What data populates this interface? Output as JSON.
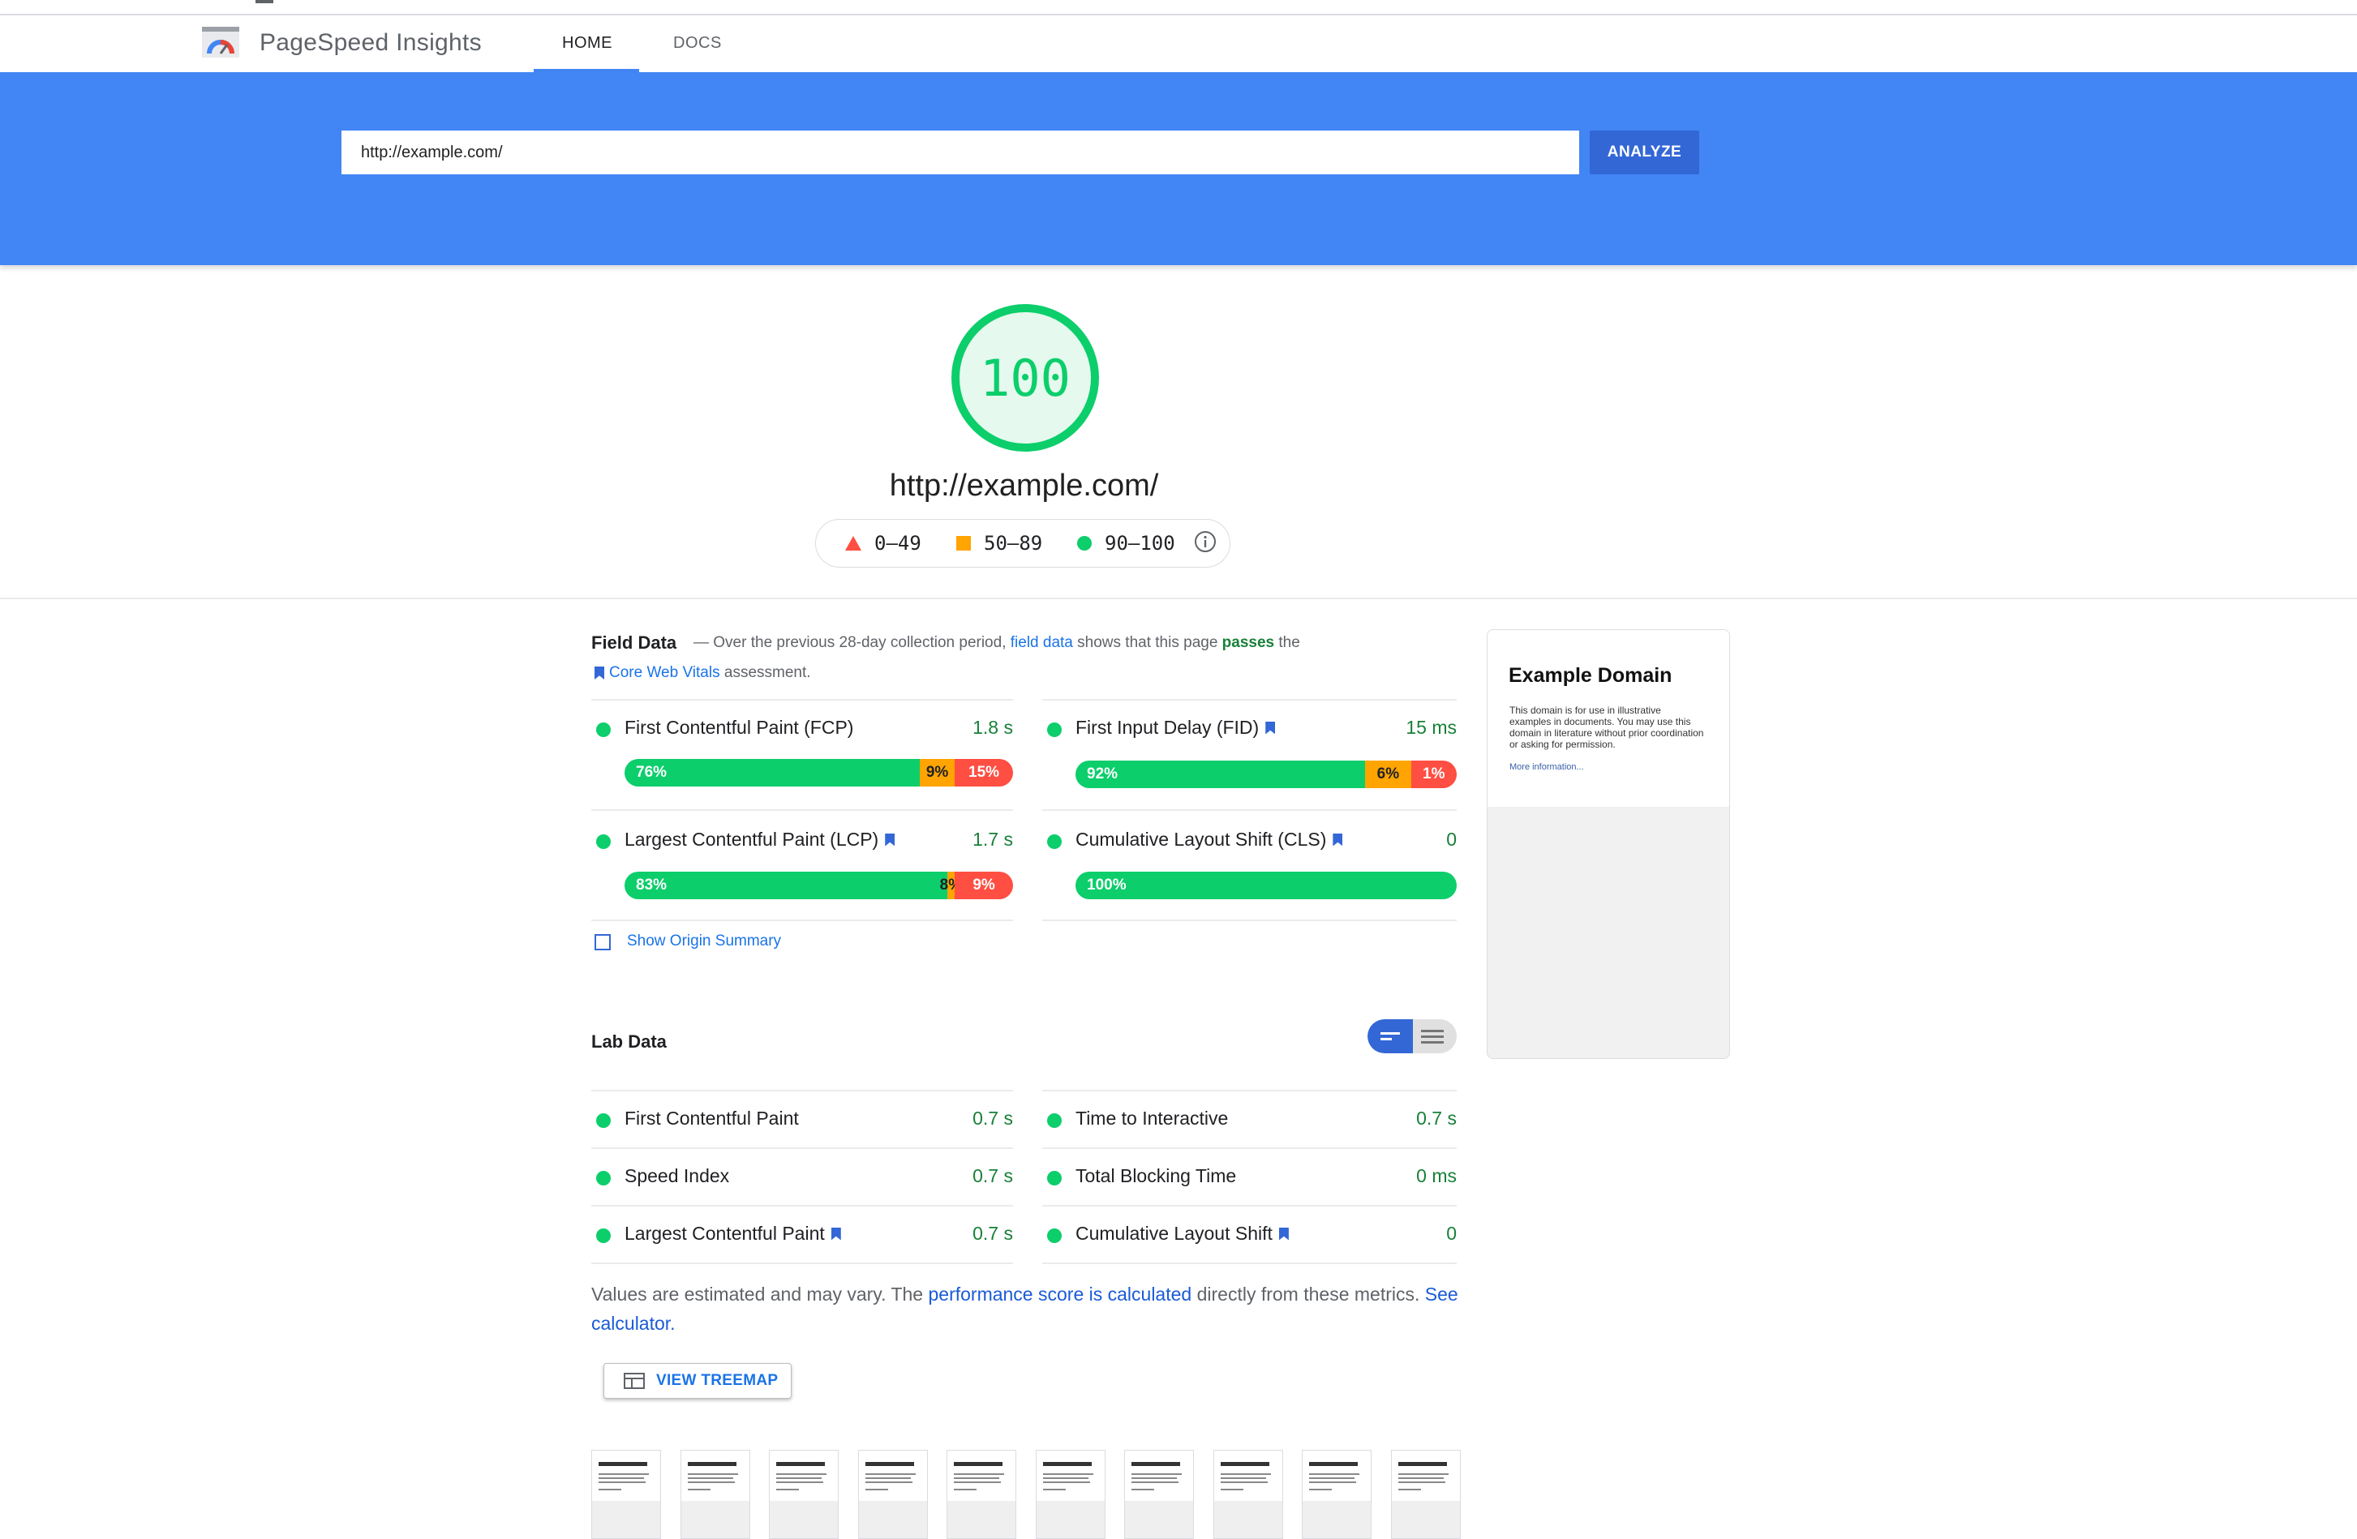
{
  "header": {
    "brand": "PageSpeed Insights",
    "tabs": [
      {
        "label": "HOME"
      },
      {
        "label": "DOCS"
      }
    ]
  },
  "search": {
    "url_value": "http://example.com/",
    "analyze_label": "ANALYZE"
  },
  "score": {
    "value": "100",
    "url": "http://example.com/"
  },
  "legend": {
    "low": "0–49",
    "mid": "50–89",
    "high": "90–100"
  },
  "colors": {
    "pass": "#0cce6b",
    "average": "#ffa400",
    "fail": "#ff4e42",
    "accent": "#4285f4"
  },
  "field_data": {
    "title": "Field Data",
    "desc_prefix": "— Over the previous 28-day collection period,",
    "desc_link": "field data",
    "desc_mid": "shows that this page",
    "desc_pass": "passes",
    "desc_end": "the",
    "cwv_link": "Core Web Vitals",
    "assessment": "assessment.",
    "metrics": [
      {
        "name": "First Contentful Paint (FCP)",
        "value": "1.8 s",
        "good": "76%",
        "avg": "9%",
        "poor": "15%",
        "good_pct": 76,
        "avg_pct": 9,
        "poor_pct": 15
      },
      {
        "name": "First Input Delay (FID)",
        "value": "15 ms",
        "good": "92%",
        "avg": "6%",
        "poor": "1%",
        "good_pct": 76,
        "avg_pct": 12,
        "poor_pct": 12
      },
      {
        "name": "Largest Contentful Paint (LCP)",
        "value": "1.7 s",
        "good": "83%",
        "avg": "8%",
        "poor": "9%",
        "good_pct": 83,
        "avg_pct": 2,
        "poor_pct": 15
      },
      {
        "name": "Cumulative Layout Shift (CLS)",
        "value": "0",
        "good": "100%",
        "good_pct": 100
      }
    ],
    "origin_summary": "Show Origin Summary"
  },
  "lab_data": {
    "title": "Lab Data",
    "metrics": [
      {
        "name": "First Contentful Paint",
        "value": "0.7 s"
      },
      {
        "name": "Time to Interactive",
        "value": "0.7 s"
      },
      {
        "name": "Speed Index",
        "value": "0.7 s"
      },
      {
        "name": "Total Blocking Time",
        "value": "0 ms"
      },
      {
        "name": "Largest Contentful Paint",
        "value": "0.7 s"
      },
      {
        "name": "Cumulative Layout Shift",
        "value": "0"
      }
    ],
    "note_a": "Values are estimated and may vary. The",
    "note_link": "performance score is calculated",
    "note_b": "directly from these metrics.",
    "note_link2": "See calculator.",
    "treemap_label": "VIEW TREEMAP"
  },
  "screenshot": {
    "heading": "Example Domain",
    "body": "This domain is for use in illustrative examples in documents. You may use this domain in literature without prior coordination or asking for permission.",
    "link": "More information..."
  }
}
